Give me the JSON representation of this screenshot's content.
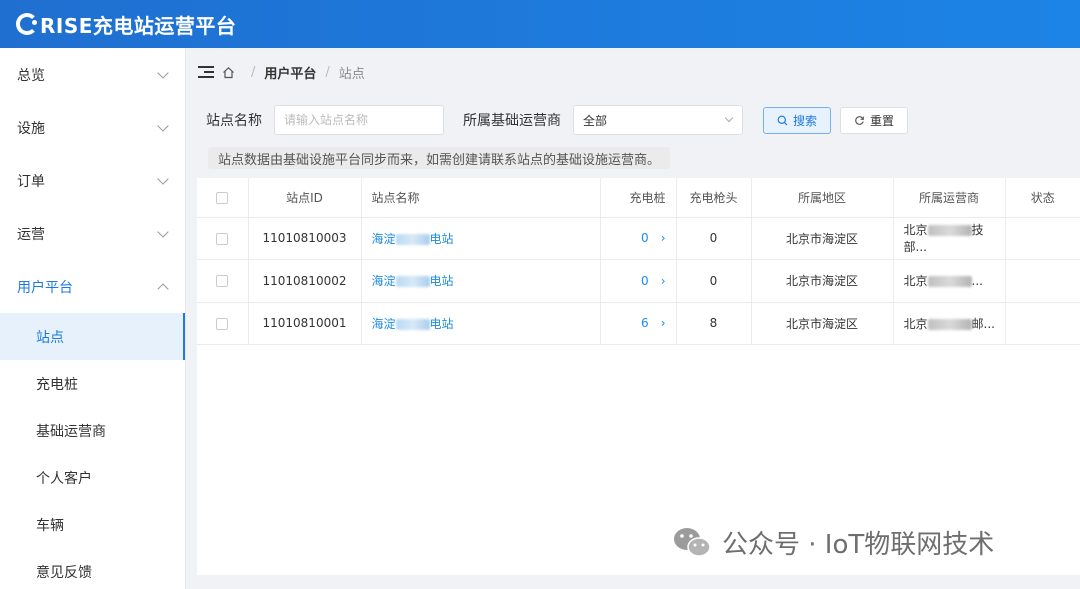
{
  "app": {
    "logo_text": "RISE充电站运营平台"
  },
  "sidebar": {
    "groups": [
      {
        "label": "总览"
      },
      {
        "label": "设施"
      },
      {
        "label": "订单"
      },
      {
        "label": "运营"
      },
      {
        "label": "用户平台"
      }
    ],
    "items": [
      {
        "label": "站点"
      },
      {
        "label": "充电桩"
      },
      {
        "label": "基础运营商"
      },
      {
        "label": "个人客户"
      },
      {
        "label": "车辆"
      },
      {
        "label": "意见反馈"
      }
    ]
  },
  "breadcrumb": {
    "parent": "用户平台",
    "current": "站点",
    "sep": "/"
  },
  "filters": {
    "name_label": "站点名称",
    "name_placeholder": "请输入站点名称",
    "operator_label": "所属基础运营商",
    "operator_value": "全部",
    "search_label": "搜索",
    "reset_label": "重置"
  },
  "notice": "站点数据由基础设施平台同步而来，如需创建请联系站点的基础设施运营商。",
  "table": {
    "headers": {
      "id": "站点ID",
      "name": "站点名称",
      "piles": "充电桩",
      "guns": "充电枪头",
      "region": "所属地区",
      "operator": "所属运营商",
      "status": "状态"
    },
    "rows": [
      {
        "id": "11010810003",
        "name_prefix": "海淀",
        "name_suffix": "电站",
        "piles": "0",
        "guns": "0",
        "region": "北京市海淀区",
        "operator_prefix": "北京",
        "operator_suffix": "技部..."
      },
      {
        "id": "11010810002",
        "name_prefix": "海淀",
        "name_suffix": "电站",
        "piles": "0",
        "guns": "0",
        "region": "北京市海淀区",
        "operator_prefix": "北京",
        "operator_suffix": "..."
      },
      {
        "id": "11010810001",
        "name_prefix": "海淀",
        "name_suffix": "电站",
        "piles": "6",
        "guns": "8",
        "region": "北京市海淀区",
        "operator_prefix": "北京",
        "operator_suffix": "邮..."
      }
    ]
  },
  "watermark": {
    "text": "公众号 · IoT物联网技术"
  },
  "colors": {
    "brand": "#1d7ae0",
    "link": "#1d8ce0"
  }
}
